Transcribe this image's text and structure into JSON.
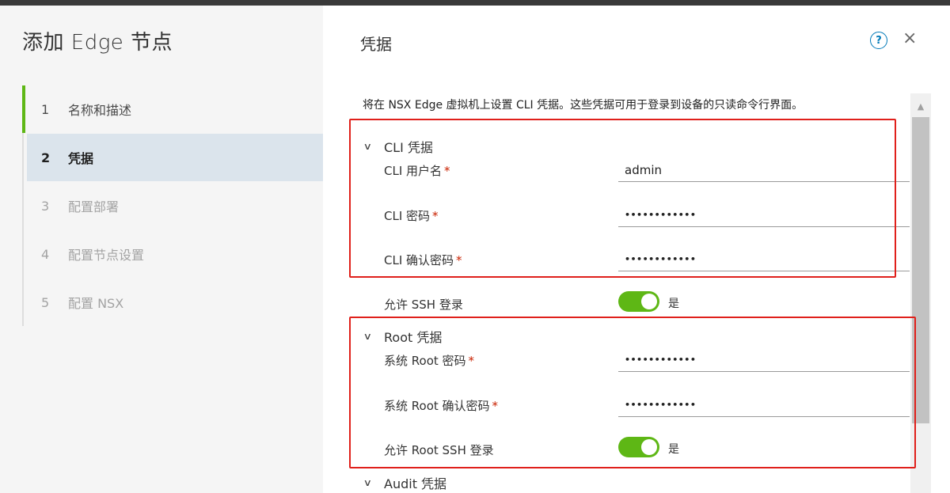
{
  "wizard": {
    "title": "添加 Edge 节点",
    "steps": [
      {
        "num": "1",
        "label": "名称和描述"
      },
      {
        "num": "2",
        "label": "凭据"
      },
      {
        "num": "3",
        "label": "配置部署"
      },
      {
        "num": "4",
        "label": "配置节点设置"
      },
      {
        "num": "5",
        "label": "配置 NSX"
      }
    ]
  },
  "header": {
    "title": "凭据",
    "help_icon": "?",
    "close_icon": "×"
  },
  "description": "将在 NSX Edge 虚拟机上设置 CLI 凭据。这些凭据可用于登录到设备的只读命令行界面。",
  "cli": {
    "header": "CLI 凭据",
    "username_label": "CLI 用户名",
    "username_value": "admin",
    "password_label": "CLI 密码",
    "password_value": "••••••••••••",
    "confirm_label": "CLI 确认密码",
    "confirm_value": "••••••••••••",
    "ssh_label": "允许 SSH 登录",
    "ssh_toggle_label": "是"
  },
  "root": {
    "header": "Root 凭据",
    "password_label": "系统 Root 密码",
    "password_value": "••••••••••••",
    "confirm_label": "系统 Root 确认密码",
    "confirm_value": "••••••••••••",
    "ssh_label": "允许 Root SSH 登录",
    "ssh_toggle_label": "是"
  },
  "audit": {
    "header": "Audit 凭据"
  },
  "required_marker": "*",
  "chevron": "∨",
  "scroll_up_icon": "▲",
  "colors": {
    "accent_green": "#5eb715",
    "highlight_red": "#e0201b",
    "active_step_bg": "#dbe4ec",
    "link_blue": "#0079b8"
  }
}
